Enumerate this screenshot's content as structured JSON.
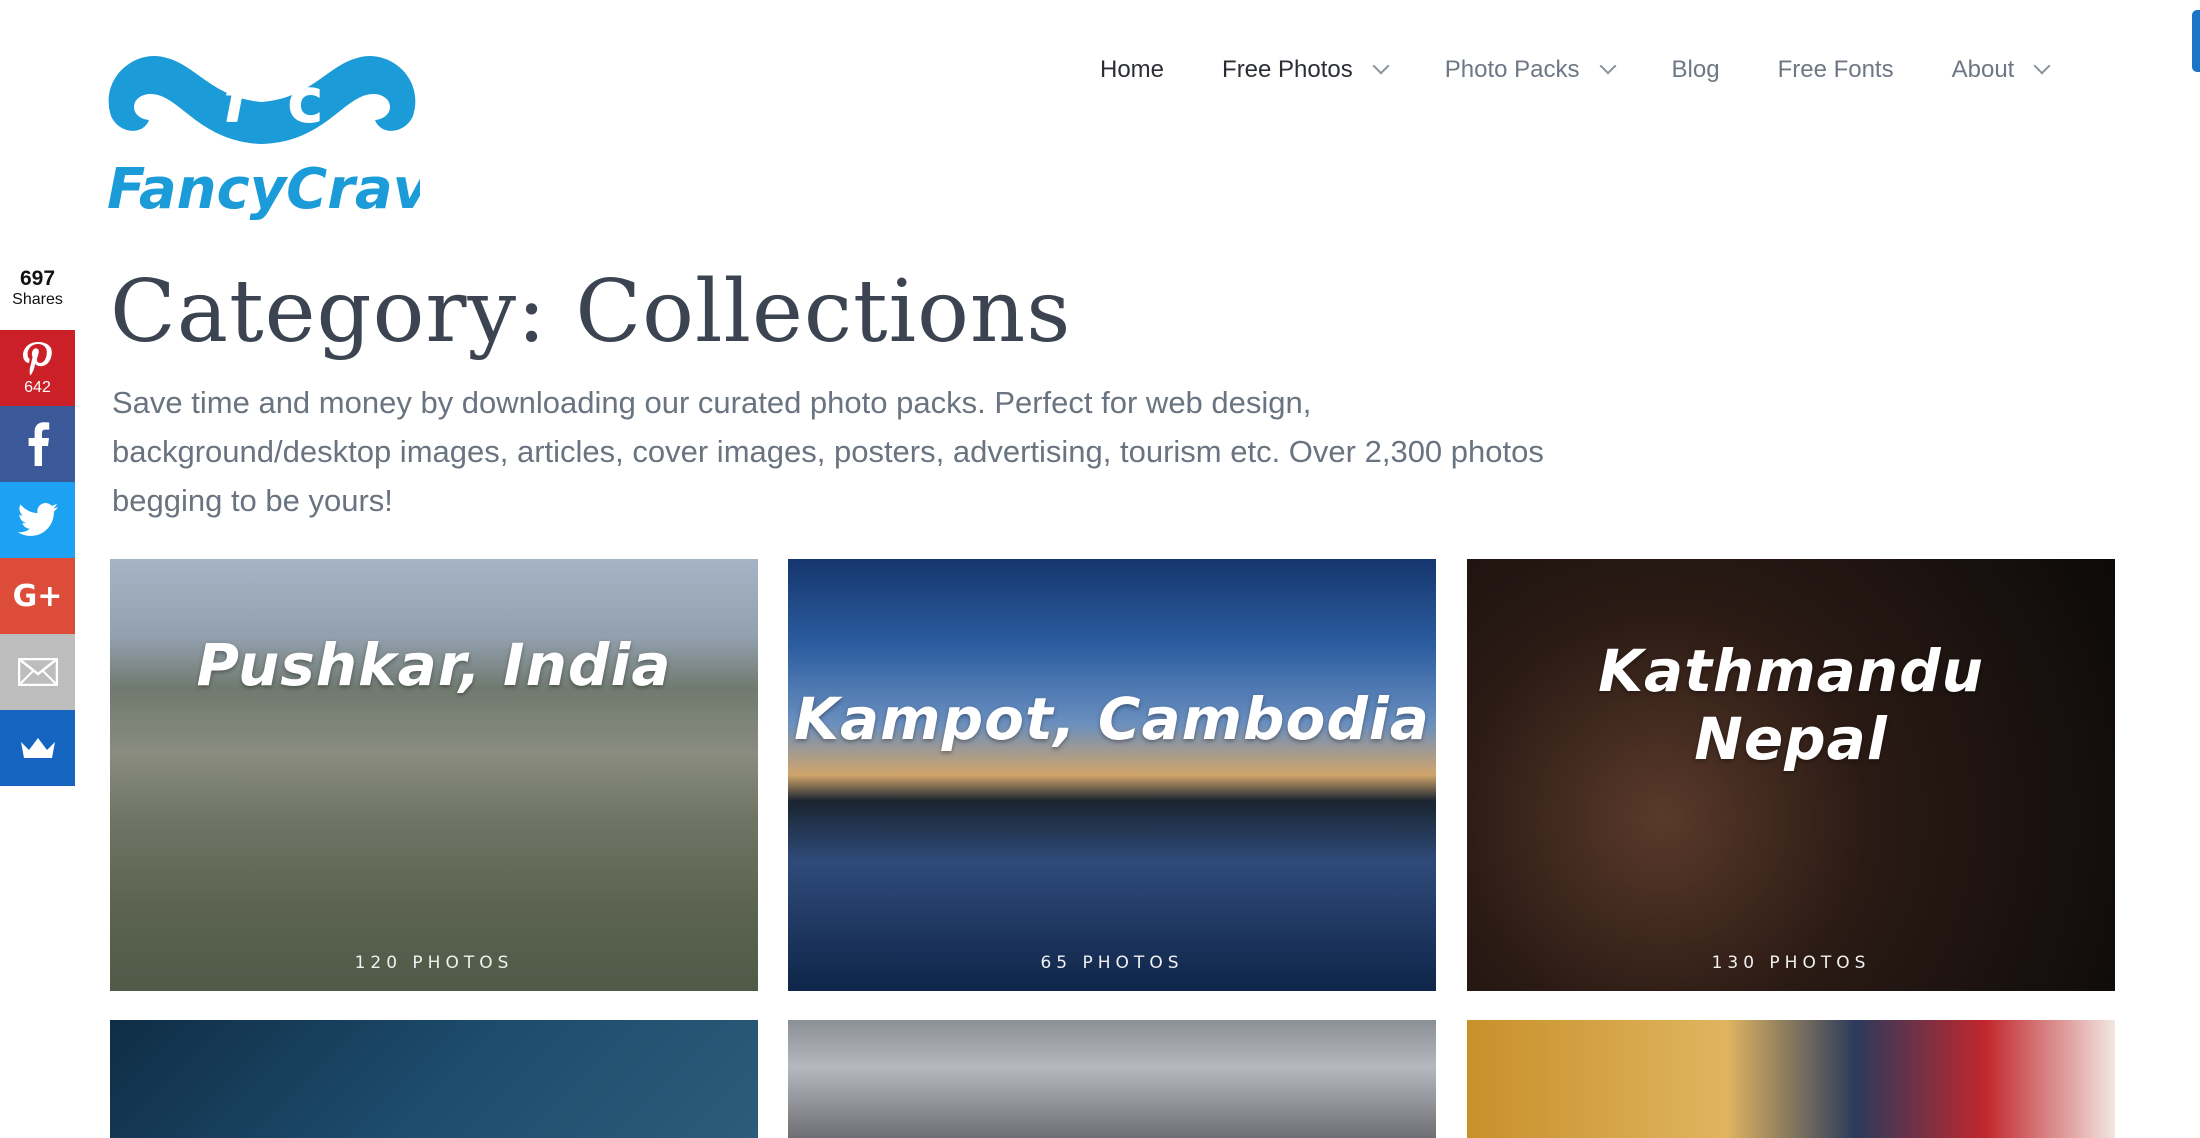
{
  "brand": {
    "logo_letters": [
      "f",
      "c"
    ],
    "logo_wordmark": "FancyCrave",
    "color": "#1b9bd7"
  },
  "nav": {
    "items": [
      {
        "label": "Home",
        "has_dropdown": false
      },
      {
        "label": "Free Photos",
        "has_dropdown": true
      },
      {
        "label": "Photo Packs",
        "has_dropdown": true
      },
      {
        "label": "Blog",
        "has_dropdown": false
      },
      {
        "label": "Free Fonts",
        "has_dropdown": false
      },
      {
        "label": "About",
        "has_dropdown": true
      }
    ]
  },
  "share": {
    "total": "697",
    "total_label": "Shares",
    "buttons": [
      {
        "network": "pinterest",
        "icon": "pinterest-icon",
        "count": "642",
        "color": "#cb2027"
      },
      {
        "network": "facebook",
        "icon": "facebook-icon",
        "color": "#3b5998"
      },
      {
        "network": "twitter",
        "icon": "twitter-icon",
        "color": "#1da1f2"
      },
      {
        "network": "google-plus",
        "icon": "google-plus-icon",
        "color": "#dd4b39"
      },
      {
        "network": "email",
        "icon": "email-icon",
        "color": "#bdbdbd"
      },
      {
        "network": "sumo",
        "icon": "crown-icon",
        "color": "#1565c0"
      }
    ]
  },
  "page": {
    "title": "Category: Collections",
    "description": "Save time and money by downloading our curated photo packs. Perfect for web design, background/desktop images, articles, cover images, posters, advertising, tourism etc. Over 2,300 photos begging to be yours!"
  },
  "collections": [
    {
      "title": "Pushkar, India",
      "count": "120 PHOTOS"
    },
    {
      "title": "Kampot, Cambodia",
      "count": "65 PHOTOS"
    },
    {
      "title_line1": "Kathmandu",
      "title_line2": "Nepal",
      "count": "130 PHOTOS"
    }
  ]
}
